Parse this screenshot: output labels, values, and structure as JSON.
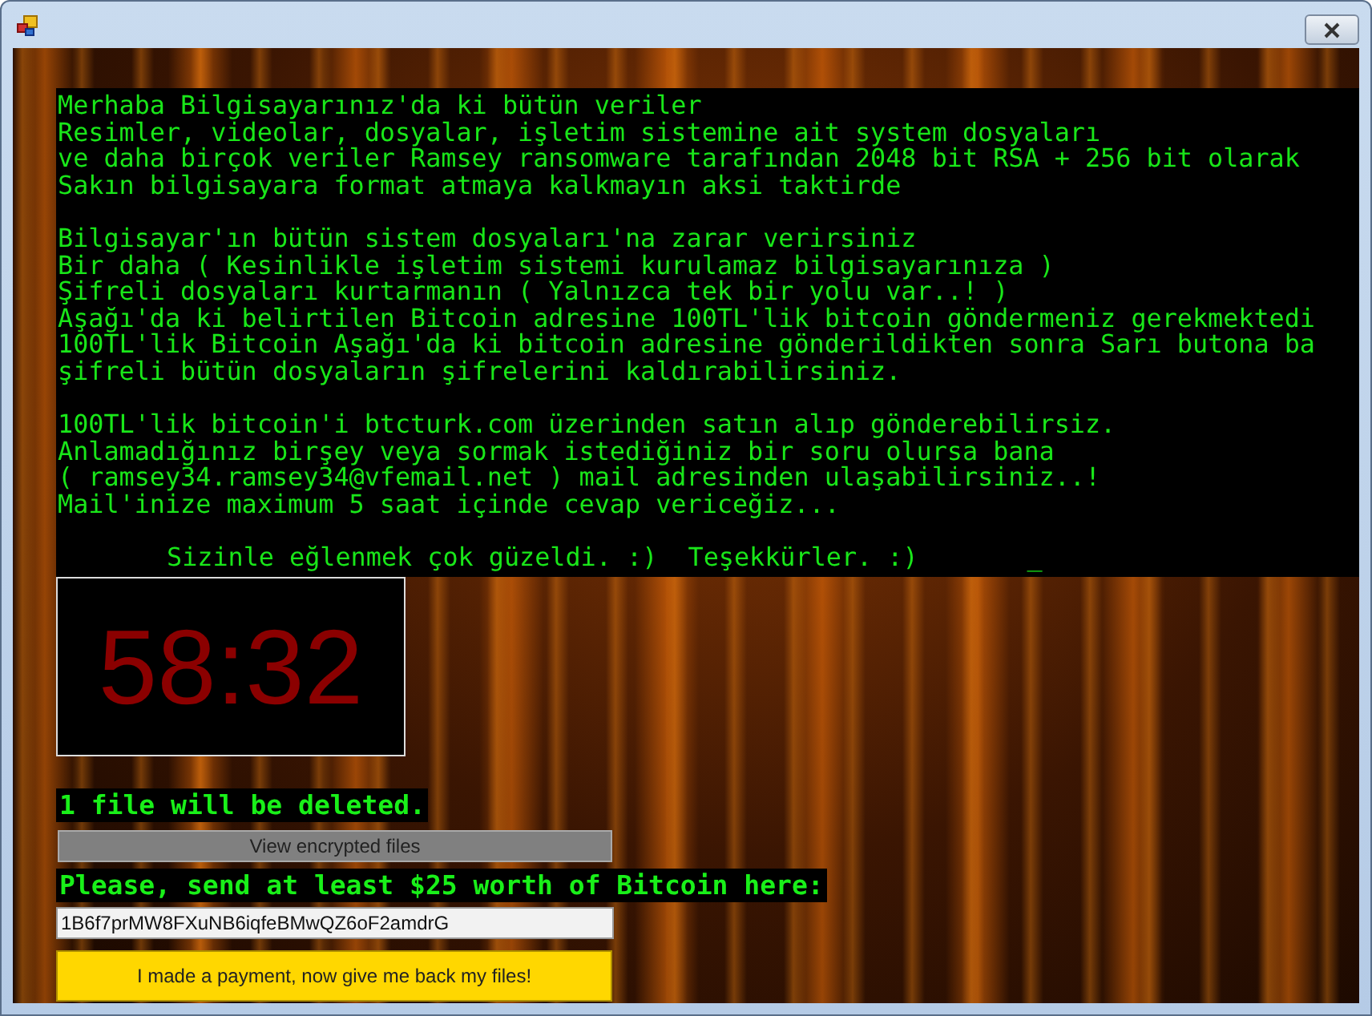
{
  "message": {
    "paragraphs": [
      [
        "Merhaba Bilgisayarınız'da ki bütün veriler",
        "Resimler, videolar, dosyalar, işletim sistemine ait system dosyaları",
        "ve daha birçok veriler Ramsey ransomware tarafından 2048 bit RSA + 256 bit olarak",
        "Sakın bilgisayara format atmaya kalkmayın aksi taktirde"
      ],
      [
        "Bilgisayar'ın bütün sistem dosyaları'na zarar verirsiniz",
        "Bir daha ( Kesinlikle işletim sistemi kurulamaz bilgisayarınıza )",
        "Şifreli dosyaları kurtarmanın ( Yalnızca tek bir yolu var..! )",
        "Aşağı'da ki belirtilen Bitcoin adresine 100TL'lik bitcoin göndermeniz gerekmektedi",
        "100TL'lik Bitcoin Aşağı'da ki bitcoin adresine gönderildikten sonra Sarı butona ba",
        "şifreli bütün dosyaların şifrelerini kaldırabilirsiniz."
      ],
      [
        "100TL'lik bitcoin'i btcturk.com üzerinden satın alıp gönderebilirsiz.",
        "Anlamadığınız birşey veya sormak istediğiniz bir soru olursa bana",
        "( ramsey34.ramsey34@vfemail.net ) mail adresinden ulaşabilirsiniz..!",
        "Mail'inize maximum 5 saat içinde cevap vericeğiz..."
      ]
    ],
    "closing": "Sizinle eğlenmek çok güzeldi. :)  Teşekkürler. :)",
    "cursor": "_"
  },
  "timer": "58:32",
  "files_notice": "1 file will be deleted.",
  "view_button": "View encrypted files",
  "send_label": "Please, send at least $25 worth of Bitcoin here:",
  "bitcoin_address": "1B6f7prMW8FXuNB6iqfeBMwQZ6oF2amdrG",
  "payment_button": "I made a payment, now give me back my files!"
}
